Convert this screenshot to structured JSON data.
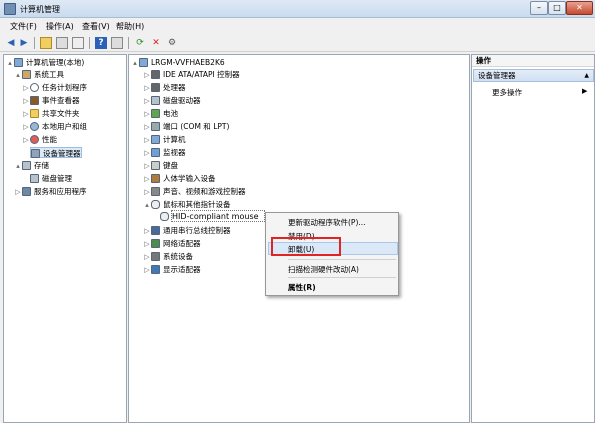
{
  "window": {
    "title": "计算机管理"
  },
  "titlebar_buttons": {
    "min": "–",
    "max": "□",
    "close": "✕"
  },
  "menu": [
    "文件(F)",
    "操作(A)",
    "查看(V)",
    "帮助(H)"
  ],
  "left_tree": [
    {
      "label": "计算机管理(本地)",
      "icon": "computer-icon"
    },
    {
      "label": "系统工具",
      "icon": "tools-icon"
    },
    {
      "label": "任务计划程序",
      "icon": "clock-icon"
    },
    {
      "label": "事件查看器",
      "icon": "event-viewer-icon"
    },
    {
      "label": "共享文件夹",
      "icon": "folder-icon"
    },
    {
      "label": "本地用户和组",
      "icon": "users-icon"
    },
    {
      "label": "性能",
      "icon": "performance-icon"
    },
    {
      "label": "设备管理器",
      "icon": "device-manager-icon"
    },
    {
      "label": "存储",
      "icon": "storage-icon"
    },
    {
      "label": "磁盘管理",
      "icon": "disk-icon"
    },
    {
      "label": "服务和应用程序",
      "icon": "services-icon"
    }
  ],
  "device_tree": {
    "root": "LRGM-VVFHAEB2K6",
    "categories": [
      "IDE ATA/ATAPI 控制器",
      "处理器",
      "磁盘驱动器",
      "电池",
      "端口 (COM 和 LPT)",
      "计算机",
      "监视器",
      "键盘",
      "人体学输入设备",
      "声音、视频和游戏控制器",
      "鼠标和其他指针设备",
      "通用串行总线控制器",
      "网络适配器",
      "系统设备",
      "显示适配器"
    ],
    "selected_device": "HID-compliant mouse"
  },
  "context_menu": {
    "update_driver": "更新驱动程序软件(P)...",
    "disable": "禁用(D)",
    "uninstall": "卸载(U)",
    "scan_hardware": "扫描检测硬件改动(A)",
    "properties": "属性(R)"
  },
  "actions_pane": {
    "header": "操作",
    "section": "设备管理器",
    "more": "更多操作"
  },
  "highlight_color": "#e02424"
}
